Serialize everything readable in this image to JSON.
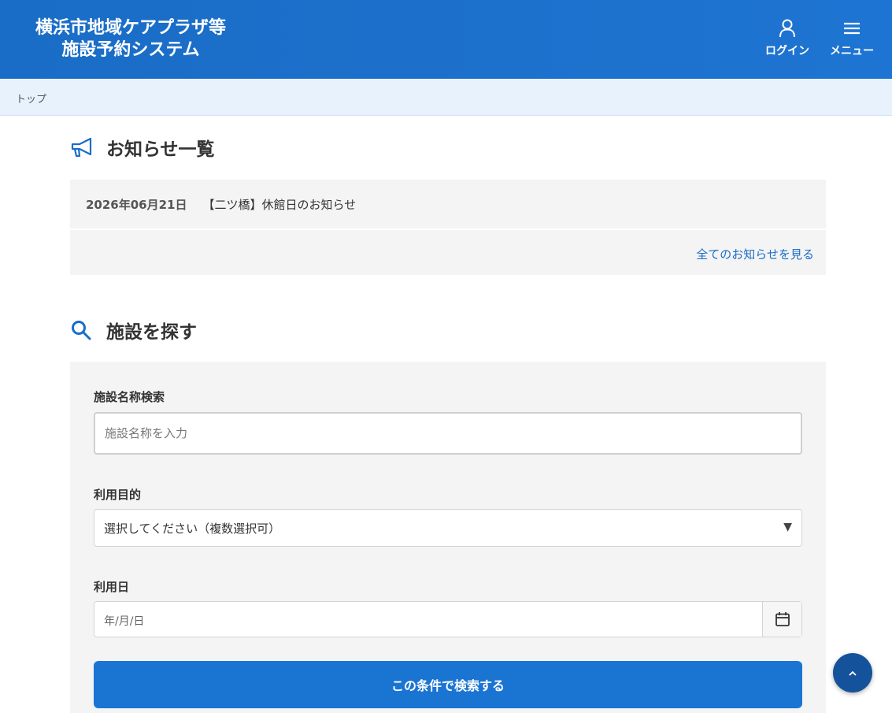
{
  "header": {
    "title_line1": "横浜市地域ケアプラザ等",
    "title_line2": "施設予約システム",
    "login_label": "ログイン",
    "menu_label": "メニュー"
  },
  "breadcrumb": {
    "top": "トップ"
  },
  "news": {
    "title": "お知らせ一覧",
    "items": [
      {
        "date": "2026年06月21日",
        "text": "【二ツ橋】休館日のお知らせ"
      }
    ],
    "view_all": "全てのお知らせを見る"
  },
  "search": {
    "title": "施設を探す",
    "name_label": "施設名称検索",
    "name_placeholder": "施設名称を入力",
    "purpose_label": "利用目的",
    "purpose_value": "選択してください（複数選択可）",
    "date_label": "利用日",
    "date_placeholder": "年/月/日",
    "submit_label": "この条件で検索する"
  },
  "icons": {
    "login": "user-icon",
    "menu": "hamburger-icon",
    "news": "megaphone-icon",
    "search": "search-icon",
    "calendar": "calendar-icon",
    "to_top": "chevron-up-icon"
  },
  "colors": {
    "primary": "#1a6dc6",
    "breadcrumb_bg": "#e7f2fd",
    "panel_bg": "#f4f4f4",
    "to_top_bg": "#14539b"
  }
}
